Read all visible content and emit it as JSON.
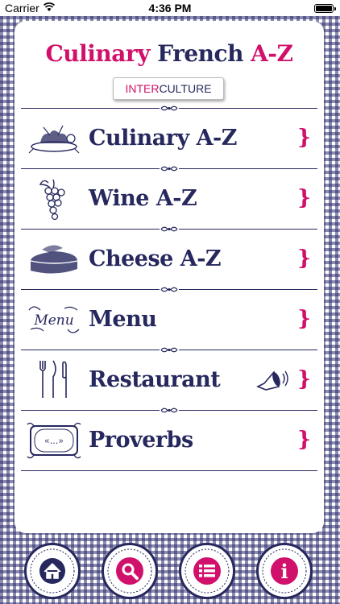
{
  "status_bar": {
    "carrier": "Carrier",
    "time": "4:36 PM"
  },
  "header": {
    "title_part1": "Culinary",
    "title_part2": "French",
    "title_part3": "A-Z",
    "logo_part1": "INTER",
    "logo_part2": "CULTURE"
  },
  "menu": {
    "items": [
      {
        "label": "Culinary A-Z",
        "icon": "culinary-engraving-icon"
      },
      {
        "label": "Wine A-Z",
        "icon": "grapes-icon"
      },
      {
        "label": "Cheese A-Z",
        "icon": "cheese-icon"
      },
      {
        "label": "Menu",
        "icon": "menu-card-icon"
      },
      {
        "label": "Restaurant",
        "icon": "cutlery-icon",
        "extra_icon": "speaker-icon"
      },
      {
        "label": "Proverbs",
        "icon": "proverb-frame-icon",
        "frame_text": "«...»"
      }
    ],
    "chevron": "}"
  },
  "toolbar": {
    "buttons": [
      "home-icon",
      "search-icon",
      "list-icon",
      "info-icon"
    ],
    "info_glyph": "i"
  },
  "colors": {
    "navy": "#26285e",
    "pink": "#d0106a"
  }
}
